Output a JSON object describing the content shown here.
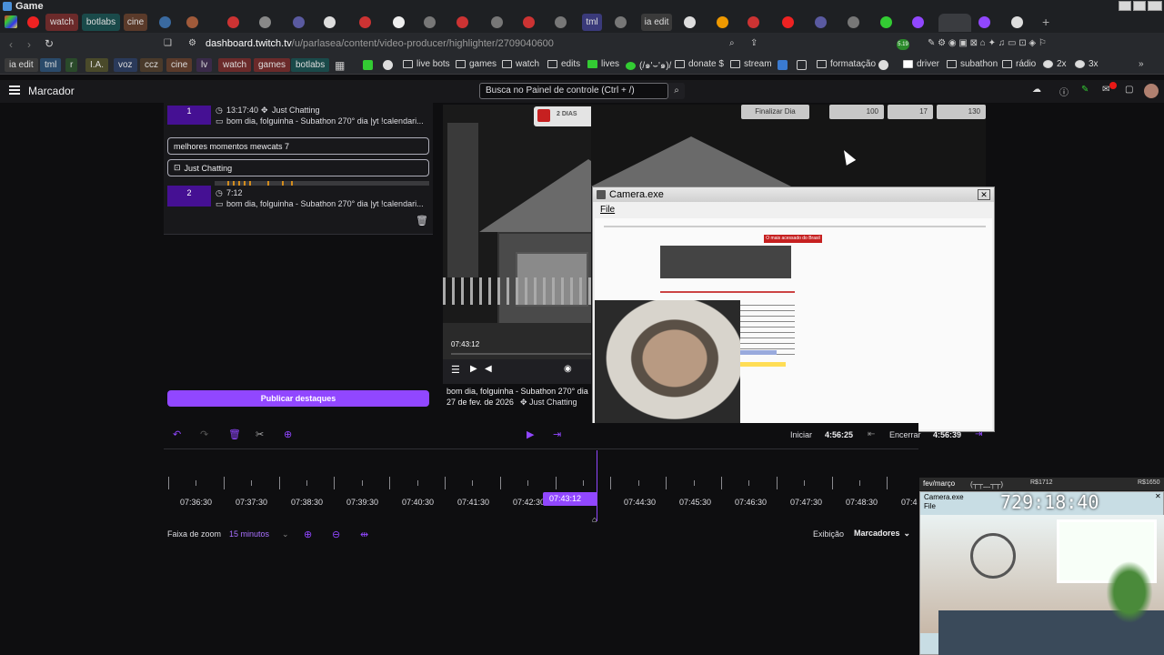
{
  "window": {
    "title": "Game"
  },
  "tabs": [
    {
      "label": "watch",
      "bg": "#6b2a2a"
    },
    {
      "label": "botlabs",
      "bg": "#1a4a4a"
    },
    {
      "label": "cine",
      "bg": "#5a3a2a"
    },
    {
      "label": "tml",
      "bg": "#3a3a7a"
    },
    {
      "label": "ia edit",
      "bg": "#3a3a3a"
    }
  ],
  "address": {
    "host": "dashboard.twitch.tv",
    "path": "/u/parlasea/content/video-producer/highlighter/2709040600"
  },
  "badge": {
    "count": "5.19"
  },
  "bookmarks": {
    "chips": [
      {
        "label": "ia edit",
        "bg": "#3a3a3a"
      },
      {
        "label": "tml",
        "bg": "#2a4a6a"
      },
      {
        "label": "r",
        "bg": "#2a4a2a"
      },
      {
        "label": "I.A.",
        "bg": "#4a4a2a"
      },
      {
        "label": "voz",
        "bg": "#2a3a5a"
      },
      {
        "label": "ccz",
        "bg": "#4a3a2a"
      },
      {
        "label": "cine",
        "bg": "#5a3a2a"
      },
      {
        "label": "lv",
        "bg": "#3a2a4a"
      },
      {
        "label": "watch",
        "bg": "#6b2a2a"
      },
      {
        "label": "games",
        "bg": "#6b2a2a"
      },
      {
        "label": "botlabs",
        "bg": "#1a4a4a"
      }
    ],
    "items": [
      "live bots",
      "games",
      "watch",
      "edits",
      "lives",
      "(/๑'⌣'๑)/",
      "donate $",
      "stream",
      "formatação",
      "driver",
      "subathon",
      "rádio",
      "2x",
      "3x"
    ]
  },
  "header": {
    "menu_icon": "hamburger-icon",
    "title": "Marcador",
    "search_placeholder": "Busca no Painel de controle (Ctrl + /)"
  },
  "highlights": {
    "items": [
      {
        "number": "1",
        "time": "13:17:40",
        "category": "Just Chatting",
        "title": "bom dia, folguinha - Subathon 270° dia |yt !calendari..."
      },
      {
        "number": "2",
        "time": "7:12",
        "title": "bom dia, folguinha - Subathon 270° dia |yt !calendari..."
      }
    ],
    "edit_title": "melhores momentos mewcats 7",
    "edit_category": "Just Chatting",
    "publish_label": "Publicar destaques"
  },
  "game": {
    "days": "2 DIAS",
    "finish_day": "Finalizar Dia",
    "stat1": "100",
    "stat2": "17",
    "stat3": "130"
  },
  "player": {
    "timestamp": "07:43:12",
    "title": "bom dia, folguinha - Subathon 270° dia",
    "date": "27 de fev. de 2026",
    "category": "Just Chatting"
  },
  "camera_window": {
    "title": "Camera.exe",
    "menu": "File",
    "banner": "O mais acessado do Brasil"
  },
  "timeline": {
    "start_label": "Iniciar",
    "start_value": "4:56:25",
    "end_label": "Encerrar",
    "end_value": "4:56:39",
    "ticks": [
      "07:36:30",
      "07:37:30",
      "07:38:30",
      "07:39:30",
      "07:40:30",
      "07:41:30",
      "07:42:30",
      "07:44:30",
      "07:45:30",
      "07:46:30",
      "07:47:30",
      "07:48:30",
      "07:4"
    ],
    "playhead": "07:43:12",
    "zoom_label": "Faixa de zoom",
    "zoom_value": "15 minutos",
    "display_label": "Exibição",
    "display_value": "Marcadores"
  },
  "overlay": {
    "month": "fev/março",
    "paren": "(┬┬﹏┬┬)",
    "amount1": "R$1712",
    "amount2": "R$1650",
    "camera_title": "Camera.exe",
    "menu": "File",
    "counter": "729:18:40"
  }
}
